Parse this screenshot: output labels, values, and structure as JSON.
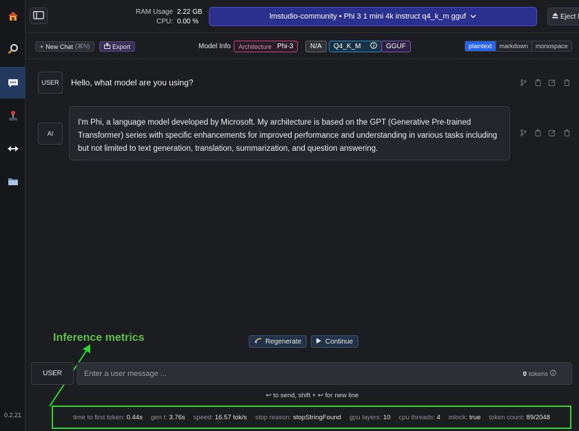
{
  "sidebar": {
    "items": [
      {
        "name": "home",
        "icon": "home-icon"
      },
      {
        "name": "search",
        "icon": "search-icon"
      },
      {
        "name": "chat",
        "icon": "chat-icon",
        "active": true
      },
      {
        "name": "playground",
        "icon": "joystick-icon"
      },
      {
        "name": "server",
        "icon": "arrows-icon"
      },
      {
        "name": "models",
        "icon": "folder-icon"
      }
    ],
    "version": "0.2.21"
  },
  "topbar": {
    "ram_label": "RAM Usage",
    "ram_value": "2.22 GB",
    "cpu_label": "CPU:",
    "cpu_value": "0.00 %",
    "model_select": "lmstudio-community • Phi 3 1 mini 4k instruct q4_k_m gguf",
    "eject_label": "Eject M"
  },
  "toolbar": {
    "new_chat_label": "New Chat",
    "new_chat_hint": "(⌘N)",
    "export_label": "Export",
    "model_info_label": "Model Info",
    "architecture_key": "Architecture",
    "architecture_value": "Phi-3",
    "na_label": "N/A",
    "quant_label": "Q4_K_M",
    "format_label": "GGUF",
    "text_formats": [
      "plaintext",
      "markdown",
      "monospace"
    ],
    "active_format": "plaintext"
  },
  "messages": [
    {
      "role": "USER",
      "text": "Hello, what model are you using?"
    },
    {
      "role": "AI",
      "text": "I'm Phi, a language model developed by Microsoft. My architecture is based on the GPT (Generative Pre-trained Transformer) series with specific enhancements for improved performance and understanding in various tasks including but not limited to text generation, translation, summarization, and question answering."
    }
  ],
  "annotation": {
    "label": "Inference metrics",
    "color": "#2fd42f"
  },
  "actions": {
    "regenerate_label": "Regenerate",
    "continue_label": "Continue"
  },
  "input": {
    "role_label": "USER",
    "placeholder": "Enter a user message ...",
    "value": "",
    "token_count": "0",
    "token_label": "tokens"
  },
  "send_hint": "↩ to send, shift + ↩ for new line",
  "metrics": [
    {
      "key": "time to first token:",
      "value": "0.44s"
    },
    {
      "key": "gen t:",
      "value": "3.76s"
    },
    {
      "key": "speed:",
      "value": "16.57 tok/s"
    },
    {
      "key": "stop reason:",
      "value": "stopStringFound"
    },
    {
      "key": "gpu layers:",
      "value": "10"
    },
    {
      "key": "cpu threads:",
      "value": "4"
    },
    {
      "key": "mlock:",
      "value": "true"
    },
    {
      "key": "token count:",
      "value": "89/2048"
    }
  ],
  "colors": {
    "accent": "#2563eb",
    "model_select_bg": "#2b2f8e",
    "sidebar_active": "#233a5e",
    "annotation": "#5fbf4a"
  }
}
